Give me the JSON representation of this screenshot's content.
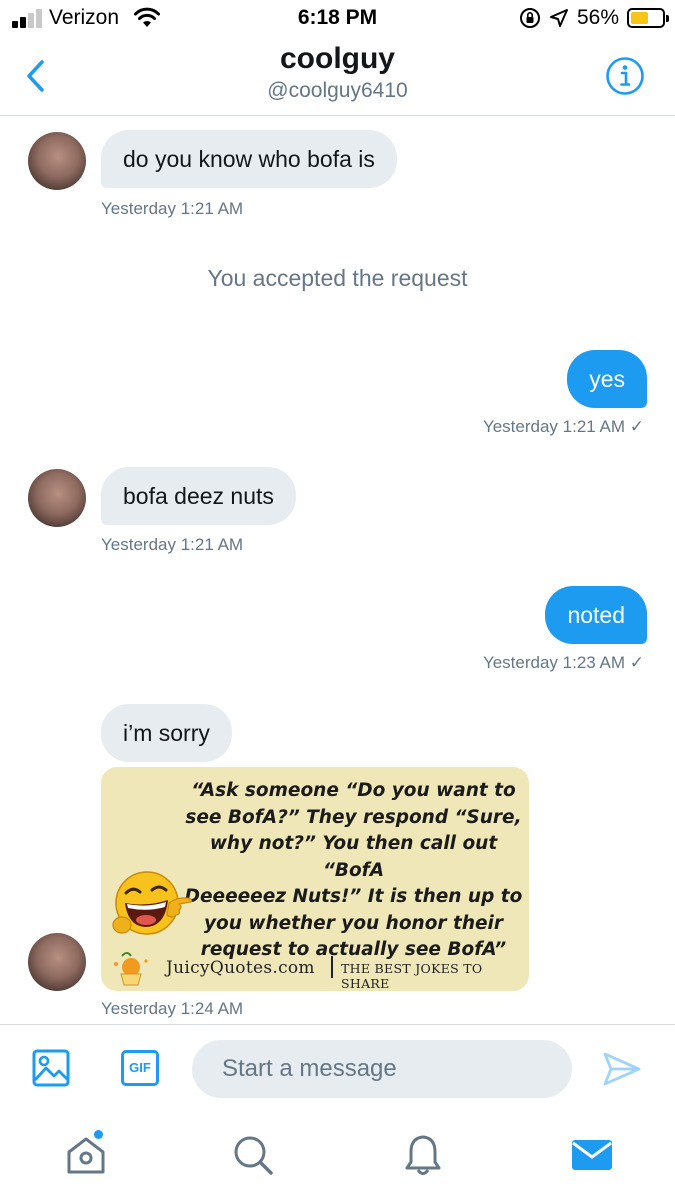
{
  "status_bar": {
    "carrier": "Verizon",
    "time": "6:18 PM",
    "battery_percent": "56%",
    "battery_level": 0.56,
    "icons": [
      "signal-bars-icon",
      "wifi-icon",
      "orientation-lock-icon",
      "location-arrow-icon",
      "battery-icon"
    ]
  },
  "header": {
    "title": "coolguy",
    "handle": "@coolguy6410",
    "icons": [
      "back-chevron-icon",
      "info-icon"
    ]
  },
  "messages": [
    {
      "from": "them",
      "text": "do you know who bofa is",
      "time": "Yesterday 1:21 AM"
    },
    {
      "type": "notice",
      "text": "You accepted the request"
    },
    {
      "from": "me",
      "text": "yes",
      "time": "Yesterday 1:21 AM",
      "check": "✓"
    },
    {
      "from": "them",
      "text": "bofa deez nuts",
      "time": "Yesterday 1:21 AM"
    },
    {
      "from": "me",
      "text": "noted",
      "time": "Yesterday 1:23 AM",
      "check": "✓"
    },
    {
      "from": "them",
      "text": "i’m sorry"
    },
    {
      "from": "them",
      "type": "image",
      "joke_lines": [
        "“Ask someone “Do you want to",
        "see BofA?” They respond “Sure,",
        "why not?” You then call out “BofA",
        "Deeeeeez Nuts!” It is then up to",
        "you whether you honor their",
        "request to actually see BofA”"
      ],
      "brand": "JuicyQuotes.com",
      "tagline": "THE BEST JOKES TO SHARE",
      "time": "Yesterday 1:24 AM"
    }
  ],
  "composer": {
    "placeholder": "Start a message",
    "gif_label": "GIF",
    "icons": [
      "image-icon",
      "gif-icon",
      "send-icon"
    ]
  },
  "tabbar": {
    "icons": [
      "home-icon",
      "search-icon",
      "notifications-bell-icon",
      "messages-mail-icon"
    ],
    "active": "messages-mail-icon"
  },
  "colors": {
    "accent": "#1d9bf0",
    "received_bubble": "#e6ecf0",
    "muted_text": "#657786",
    "battery_fill": "#f5c518",
    "card_background": "#efe7b8"
  }
}
